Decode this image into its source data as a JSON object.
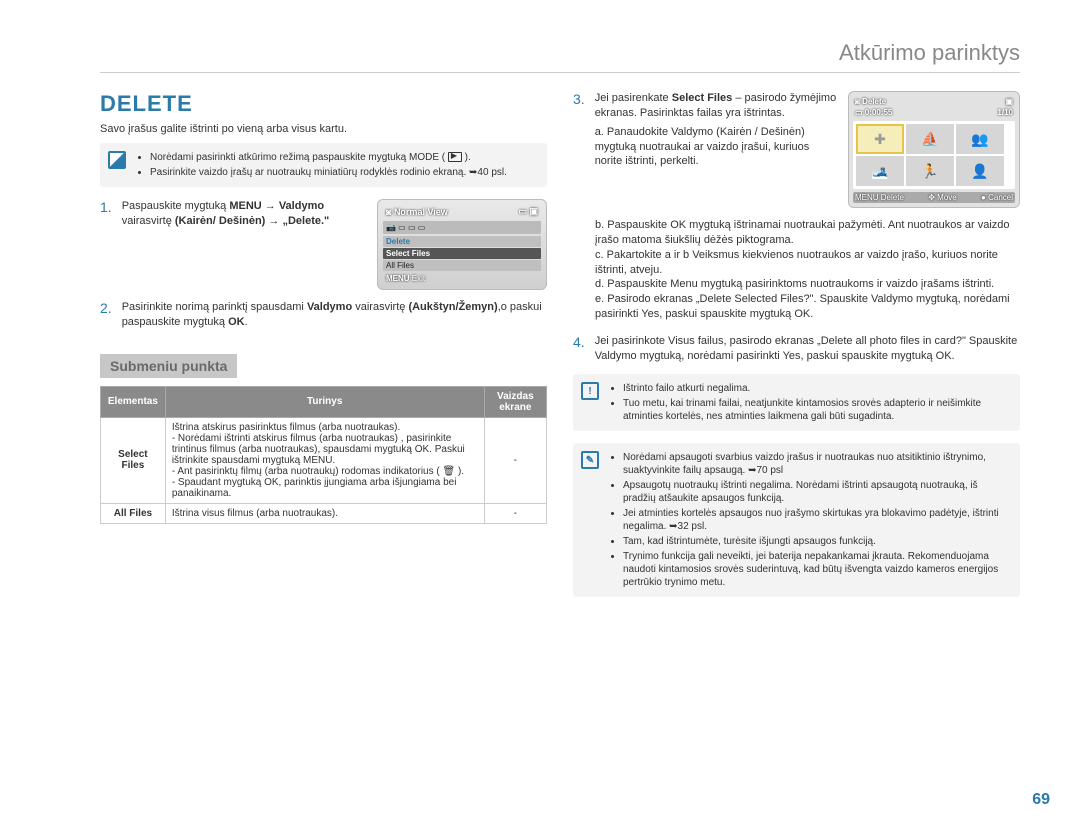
{
  "header": {
    "section_title": "Atkūrimo parinktys"
  },
  "page_number": "69",
  "left": {
    "title": "DELETE",
    "intro": "Savo įrašus galite ištrinti po vieną arba visus kartu.",
    "note1_items": [
      "Norėdami pasirinkti atkūrimo režimą paspauskite mygtuką MODE (",
      ").",
      "Pasirinkite vaizdo įrašų ar nuotraukų miniatiūrų rodyklės rodinio ekraną. ➥40 psl."
    ],
    "step1": "Paspauskite mygtuką MENU → Valdymo vairasvirtę (Kairėn/ Dešinėn) → „Delete.\"",
    "step2": "Pasirinkite norimą parinktį spausdami Valdymo vairasvirtę (Aukštyn/Žemyn),o paskui paspauskite mygtuką OK.",
    "lcd1": {
      "header": "Normal View",
      "rows": [
        "Delete",
        "Select Files",
        "All Files"
      ],
      "foot_left": "MENU",
      "foot_right": "Exit"
    },
    "submenu_label": "Submeniu punkta",
    "table": {
      "headers": [
        "Elementas",
        "Turinys",
        "Vaizdas ekrane"
      ],
      "rows": [
        {
          "el": "Select Files",
          "content": "Ištrina atskirus pasirinktus filmus (arba nuotraukas).\n- Norėdami ištrinti atskirus filmus (arba nuotraukas) , pasirinkite trintinus filmus (arba nuotraukas), spausdami mygtuką OK. Paskui ištrinkite spausdami mygtuką MENU.\n- Ant pasirinktų filmų (arba nuotraukų) rodomas indikatorius ( 🗑 ).\n- Spaudant mygtuką OK, parinktis įjungiama arba išjungiama bei panaikinama.",
          "disp": "-"
        },
        {
          "el": "All Files",
          "content": "Ištrina visus filmus (arba nuotraukas).",
          "disp": "-"
        }
      ]
    }
  },
  "right": {
    "step3_intro": "Jei pasirenkate Select Files – pasirodo žymėjimo ekranas. Pasirinktas failas yra ištrintas.",
    "step3_a": "a. Panaudokite Valdymo (Kairėn / Dešinėn) mygtuką nuotraukai ar vaizdo įrašui, kuriuos norite ištrinti, perkelti.",
    "step3_b": "b. Paspauskite OK mygtuką ištrinamai nuotraukai pažymėti. Ant nuotraukos ar vaizdo įrašo matoma šiukšlių dėžės piktograma.",
    "step3_c": "c. Pakartokite a ir b Veiksmus kiekvienos nuotraukos ar vaizdo įrašo, kuriuos norite ištrinti, atveju.",
    "step3_d": "d. Paspauskite Menu mygtuką pasirinktoms nuotraukoms ir vaizdo įrašams ištrinti.",
    "step3_e": "e. Pasirodo ekranas „Delete Selected Files?\". Spauskite Valdymo mygtuką, norėdami pasirinkti Yes, paskui spauskite mygtuką OK.",
    "step4": "Jei pasirinkote Visus failus, pasirodo ekranas „Delete all photo files in card?\" Spauskite Valdymo mygtuką, norėdami pasirinkti Yes, paskui spauskite mygtuką OK.",
    "lcd2": {
      "title": "Delete",
      "time": "0:00:55",
      "count": "1/10",
      "foot": {
        "menu": "MENU Delete",
        "move": "Move",
        "cancel": "Cancel"
      }
    },
    "warn_items": [
      "Ištrinto failo atkurti negalima.",
      "Tuo metu, kai trinami failai, neatjunkite kintamosios srovės adapterio ir neišimkite atminties kortelės, nes atminties laikmena gali būti sugadinta."
    ],
    "info_items": [
      "Norėdami apsaugoti svarbius vaizdo įrašus ir nuotraukas nuo atsitiktinio ištrynimo, suaktyvinkite failų apsaugą. ➥70 psl",
      "Apsaugotų nuotraukų ištrinti negalima. Norėdami ištrinti apsaugotą nuotrauką, iš pradžių atšaukite apsaugos funkciją.",
      "Jei atminties kortelės apsaugos nuo įrašymo skirtukas yra blokavimo padėtyje, ištrinti negalima. ➥32 psl.",
      "Tam, kad ištrintumėte, turėsite išjungti apsaugos funkciją.",
      "Trynimo funkcija gali neveikti, jei baterija nepakankamai įkrauta. Rekomenduojama naudoti kintamosios srovės suderintuvą, kad būtų išvengta vaizdo kameros energijos pertrūkio trynimo metu."
    ]
  }
}
